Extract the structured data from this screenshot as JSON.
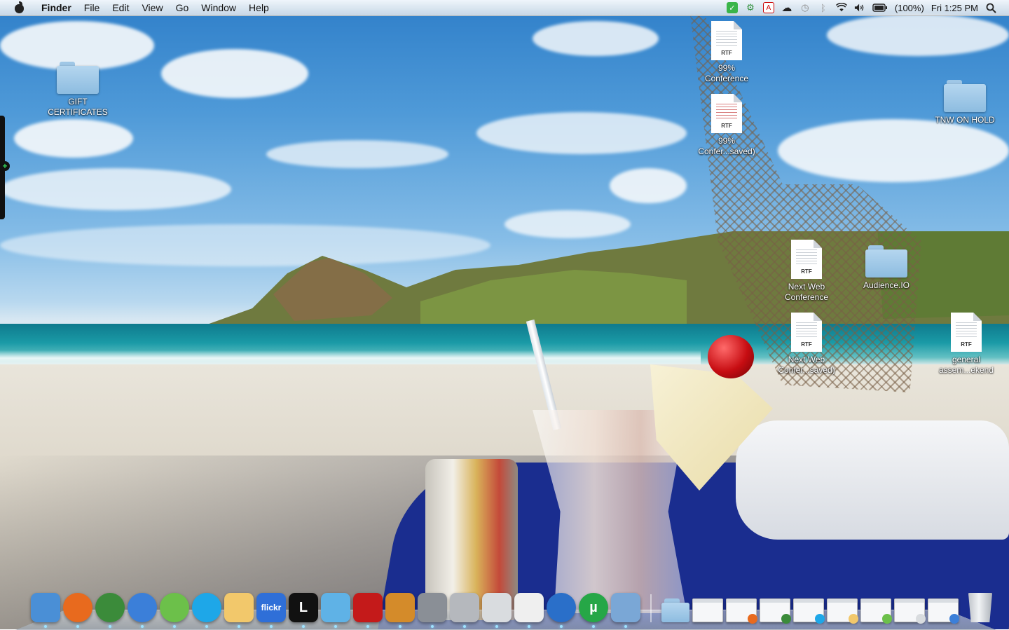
{
  "menubar": {
    "app_name": "Finder",
    "menus": [
      "File",
      "Edit",
      "View",
      "Go",
      "Window",
      "Help"
    ],
    "battery": "(100%)",
    "clock": "Fri 1:25 PM"
  },
  "desktop": {
    "icons": [
      {
        "kind": "folder",
        "label": [
          "GIFT",
          "CERTIFICATES"
        ]
      },
      {
        "kind": "document",
        "ext": "RTF",
        "label": [
          "99%",
          "Conference"
        ]
      },
      {
        "kind": "document",
        "ext": "RTF",
        "label": [
          "99%",
          "Confer...saved)"
        ]
      },
      {
        "kind": "folder",
        "label": [
          "TNW ON HOLD"
        ]
      },
      {
        "kind": "document",
        "ext": "RTF",
        "label": [
          "Next Web",
          "Conference"
        ]
      },
      {
        "kind": "folder",
        "label": [
          "Audience.IO"
        ]
      },
      {
        "kind": "document",
        "ext": "RTF",
        "label": [
          "Next Web",
          "Confer...saved)"
        ]
      },
      {
        "kind": "document",
        "ext": "RTF",
        "label": [
          "general",
          "assem...ekend"
        ]
      }
    ]
  },
  "dock": {
    "apps": [
      {
        "name": "finder-icon",
        "color": "#4a8fd6"
      },
      {
        "name": "firefox-icon",
        "color": "#e86a1e"
      },
      {
        "name": "chrome-icon",
        "color": "#3b8b3a"
      },
      {
        "name": "itunes-icon",
        "color": "#3b7fd9"
      },
      {
        "name": "spotify-icon",
        "color": "#6cc04a"
      },
      {
        "name": "skype-icon",
        "color": "#1ea7e8"
      },
      {
        "name": "preview-icon",
        "color": "#f2c86b"
      },
      {
        "name": "flickr-uploadr-icon",
        "glyph": "flickr",
        "color": "#2f6fd8"
      },
      {
        "name": "lightroom-icon",
        "glyph": "L",
        "color": "#111111"
      },
      {
        "name": "fish-app-icon",
        "color": "#5fb2e6"
      },
      {
        "name": "photo-booth-icon",
        "color": "#c41a1a"
      },
      {
        "name": "iphoto-icon",
        "color": "#d48b2a"
      },
      {
        "name": "system-preferences-icon",
        "color": "#8a8f96"
      },
      {
        "name": "imovie-icon",
        "color": "#b5b8bd"
      },
      {
        "name": "keychain-icon",
        "color": "#d9dcdf"
      },
      {
        "name": "textedit-icon",
        "color": "#efefef"
      },
      {
        "name": "quicktime-icon",
        "color": "#2a6fc9"
      },
      {
        "name": "utorrent-icon",
        "glyph": "µ",
        "color": "#26a747"
      },
      {
        "name": "mail-photos-icon",
        "color": "#7aa7d6"
      }
    ],
    "minimized": [
      {
        "name": "documents-folder-icon",
        "mini": ""
      },
      {
        "name": "minimized-window-1-icon",
        "mini": ""
      },
      {
        "name": "minimized-window-2-icon",
        "mini": "#e86a1e"
      },
      {
        "name": "minimized-window-3-icon",
        "mini": "#3b8b3a"
      },
      {
        "name": "minimized-window-4-icon",
        "mini": "#1ea7e8"
      },
      {
        "name": "minimized-window-5-icon",
        "mini": "#f2c86b"
      },
      {
        "name": "minimized-window-6-icon",
        "mini": "#6cc04a"
      },
      {
        "name": "minimized-window-7-icon",
        "mini": "#d9dcdf"
      },
      {
        "name": "minimized-window-8-icon",
        "mini": "#3b7fd9"
      }
    ]
  }
}
